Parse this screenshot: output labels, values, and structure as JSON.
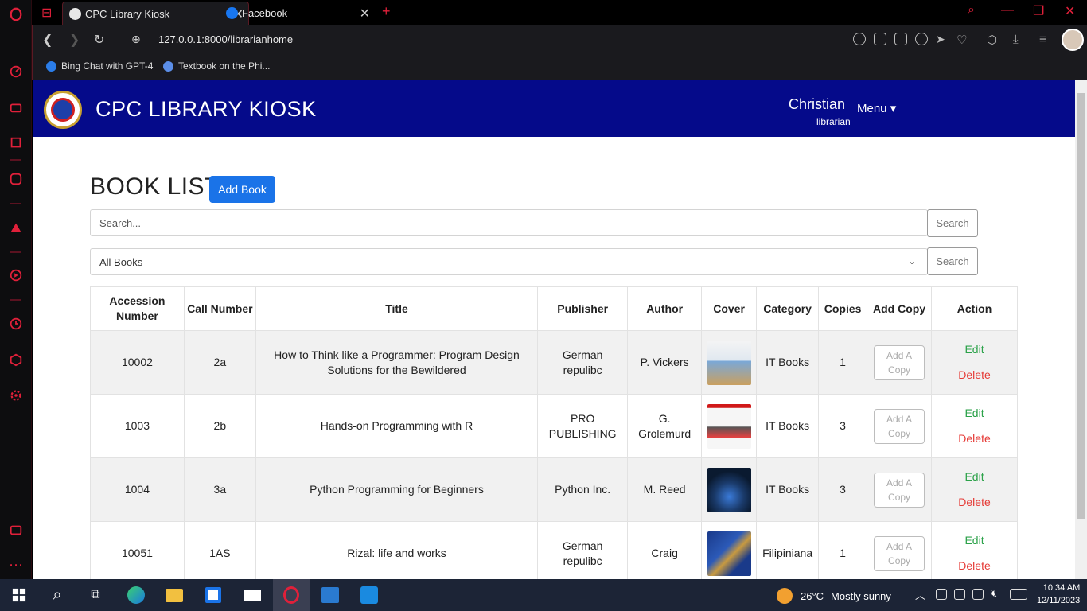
{
  "browser": {
    "tabs": [
      {
        "label": "CPC Library Kiosk",
        "active": true
      },
      {
        "label": "Facebook",
        "active": false
      }
    ],
    "new_tab": "+",
    "url": "127.0.0.1:8000/librarianhome",
    "bookmarks": [
      {
        "label": "Bing Chat with GPT-4"
      },
      {
        "label": "Textbook on the Phi..."
      }
    ]
  },
  "app": {
    "brand": "CPC LIBRARY KIOSK",
    "user_name": "Christian",
    "user_role": "librarian",
    "menu_label": "Menu ▾"
  },
  "main": {
    "heading": "BOOK LIST",
    "add_book_label": "Add Book",
    "search_placeholder": "Search...",
    "search_button": "Search",
    "filter_value": "All Books",
    "filter_button": "Search"
  },
  "table": {
    "headers": [
      "Accession Number",
      "Call Number",
      "Title",
      "Publisher",
      "Author",
      "Cover",
      "Category",
      "Copies",
      "Add Copy",
      "Action"
    ],
    "add_copy_label": "Add A Copy",
    "edit_label": "Edit",
    "delete_label": "Delete",
    "rows": [
      {
        "accession": "10002",
        "call": "2a",
        "title": "How to Think like a Programmer: Program Design Solutions for the Bewildered",
        "publisher": "German repulibc",
        "author": "P. Vickers",
        "category": "IT Books",
        "copies": "1"
      },
      {
        "accession": "1003",
        "call": "2b",
        "title": "Hands-on Programming with R",
        "publisher": "PRO PUBLISHING",
        "author": "G. Grolemurd",
        "category": "IT Books",
        "copies": "3"
      },
      {
        "accession": "1004",
        "call": "3a",
        "title": "Python Programming for Beginners",
        "publisher": "Python Inc.",
        "author": "M. Reed",
        "category": "IT Books",
        "copies": "3"
      },
      {
        "accession": "10051",
        "call": "1AS",
        "title": "Rizal: life and works",
        "publisher": "German repulibc",
        "author": "Craig",
        "category": "Filipiniana",
        "copies": "1"
      }
    ]
  },
  "taskbar": {
    "temperature": "26°C",
    "weather": "Mostly sunny",
    "time": "10:34 AM",
    "date": "12/11/2023"
  }
}
